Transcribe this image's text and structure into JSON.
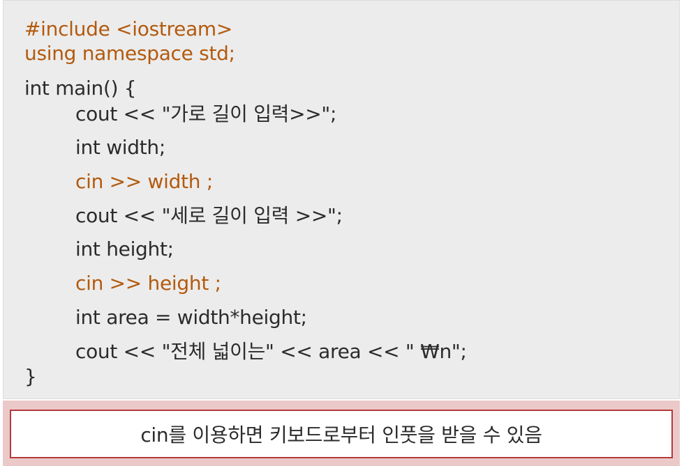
{
  "colors": {
    "panel_bg": "#ececec",
    "code_text": "#2b2b2b",
    "highlight_text": "#b35a0e",
    "note_band": "#ecc9c9",
    "note_border": "#b33a3a"
  },
  "code": {
    "lines": [
      "#include <iostream>",
      "using namespace std;",
      "int main() {",
      "cout << \"가로 길이 입력>>\";",
      "int width;",
      "cin >> width ;",
      "cout << \"세로 길이 입력 >>\";",
      "int height;",
      "cin >> height ;",
      "int area = width*height;",
      "cout << \"전체 넓이는\" << area << \" ₩n\";",
      "}"
    ]
  },
  "note": {
    "text": "cin를 이용하면 키보드로부터 인풋을 받을 수 있음"
  }
}
